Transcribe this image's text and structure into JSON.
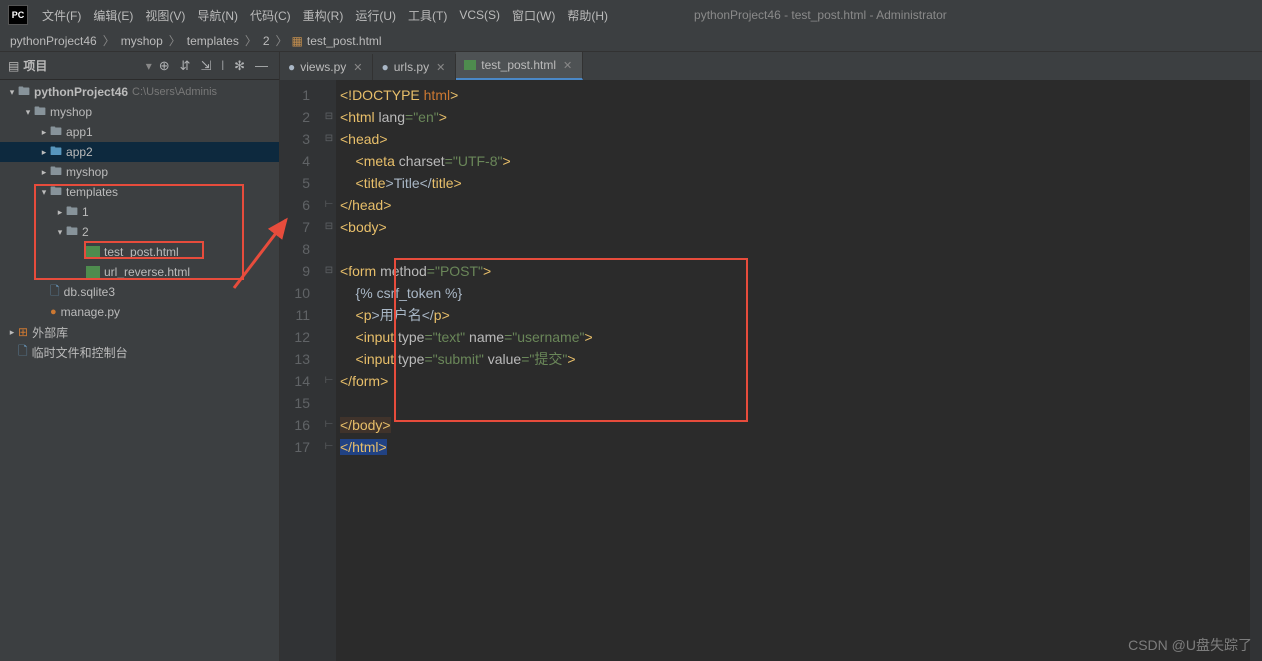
{
  "window_title": "pythonProject46 - test_post.html - Administrator",
  "app_icon": "PC",
  "menu": [
    "文件(F)",
    "编辑(E)",
    "视图(V)",
    "导航(N)",
    "代码(C)",
    "重构(R)",
    "运行(U)",
    "工具(T)",
    "VCS(S)",
    "窗口(W)",
    "帮助(H)"
  ],
  "breadcrumb": [
    "pythonProject46",
    "myshop",
    "templates",
    "2",
    "test_post.html"
  ],
  "project_panel": {
    "title": "项目",
    "tree": {
      "root": "pythonProject46",
      "root_path": "C:\\Users\\Adminis",
      "myshop": "myshop",
      "app1": "app1",
      "app2": "app2",
      "myshop_inner": "myshop",
      "templates": "templates",
      "one": "1",
      "two": "2",
      "test_post": "test_post.html",
      "url_reverse": "url_reverse.html",
      "db": "db.sqlite3",
      "manage": "manage.py",
      "ext_lib": "外部库",
      "scratches": "临时文件和控制台"
    }
  },
  "tabs": [
    {
      "label": "views.py",
      "type": "py"
    },
    {
      "label": "urls.py",
      "type": "py"
    },
    {
      "label": "test_post.html",
      "type": "html",
      "active": true
    }
  ],
  "code": {
    "lines": 17,
    "l1_a": "<!DOCTYPE ",
    "l1_b": "html",
    "l1_c": ">",
    "l2_a": "<",
    "l2_b": "html ",
    "l2_c": "lang",
    "l2_d": "=",
    "l2_e": "\"en\"",
    "l2_f": ">",
    "l3": "<head>",
    "l4_a": "    <",
    "l4_b": "meta ",
    "l4_c": "charset",
    "l4_d": "=",
    "l4_e": "\"UTF-8\"",
    "l4_f": ">",
    "l5_a": "    <",
    "l5_b": "title",
    "l5_c": ">Title</",
    "l5_d": "title",
    "l5_e": ">",
    "l6": "</head>",
    "l7": "<body>",
    "l9_a": "<",
    "l9_b": "form ",
    "l9_c": "method",
    "l9_d": "=",
    "l9_e": "\"POST\"",
    "l9_f": ">",
    "l10": "    {% csrf_token %}",
    "l11_a": "    <",
    "l11_b": "p",
    "l11_c": ">用户名</",
    "l11_d": "p",
    "l11_e": ">",
    "l12_a": "    <",
    "l12_b": "input ",
    "l12_c": "type",
    "l12_d": "=",
    "l12_e": "\"text\"",
    "l12_f": " name",
    "l12_g": "=",
    "l12_h": "\"username\"",
    "l12_i": ">",
    "l13_a": "    <",
    "l13_b": "input ",
    "l13_c": "type",
    "l13_d": "=",
    "l13_e": "\"submit\"",
    "l13_f": " value",
    "l13_g": "=",
    "l13_h": "\"提交\"",
    "l13_i": ">",
    "l14": "</form>",
    "l16": "</body>",
    "l17": "</html>"
  },
  "watermark": "CSDN @U盘失踪了"
}
